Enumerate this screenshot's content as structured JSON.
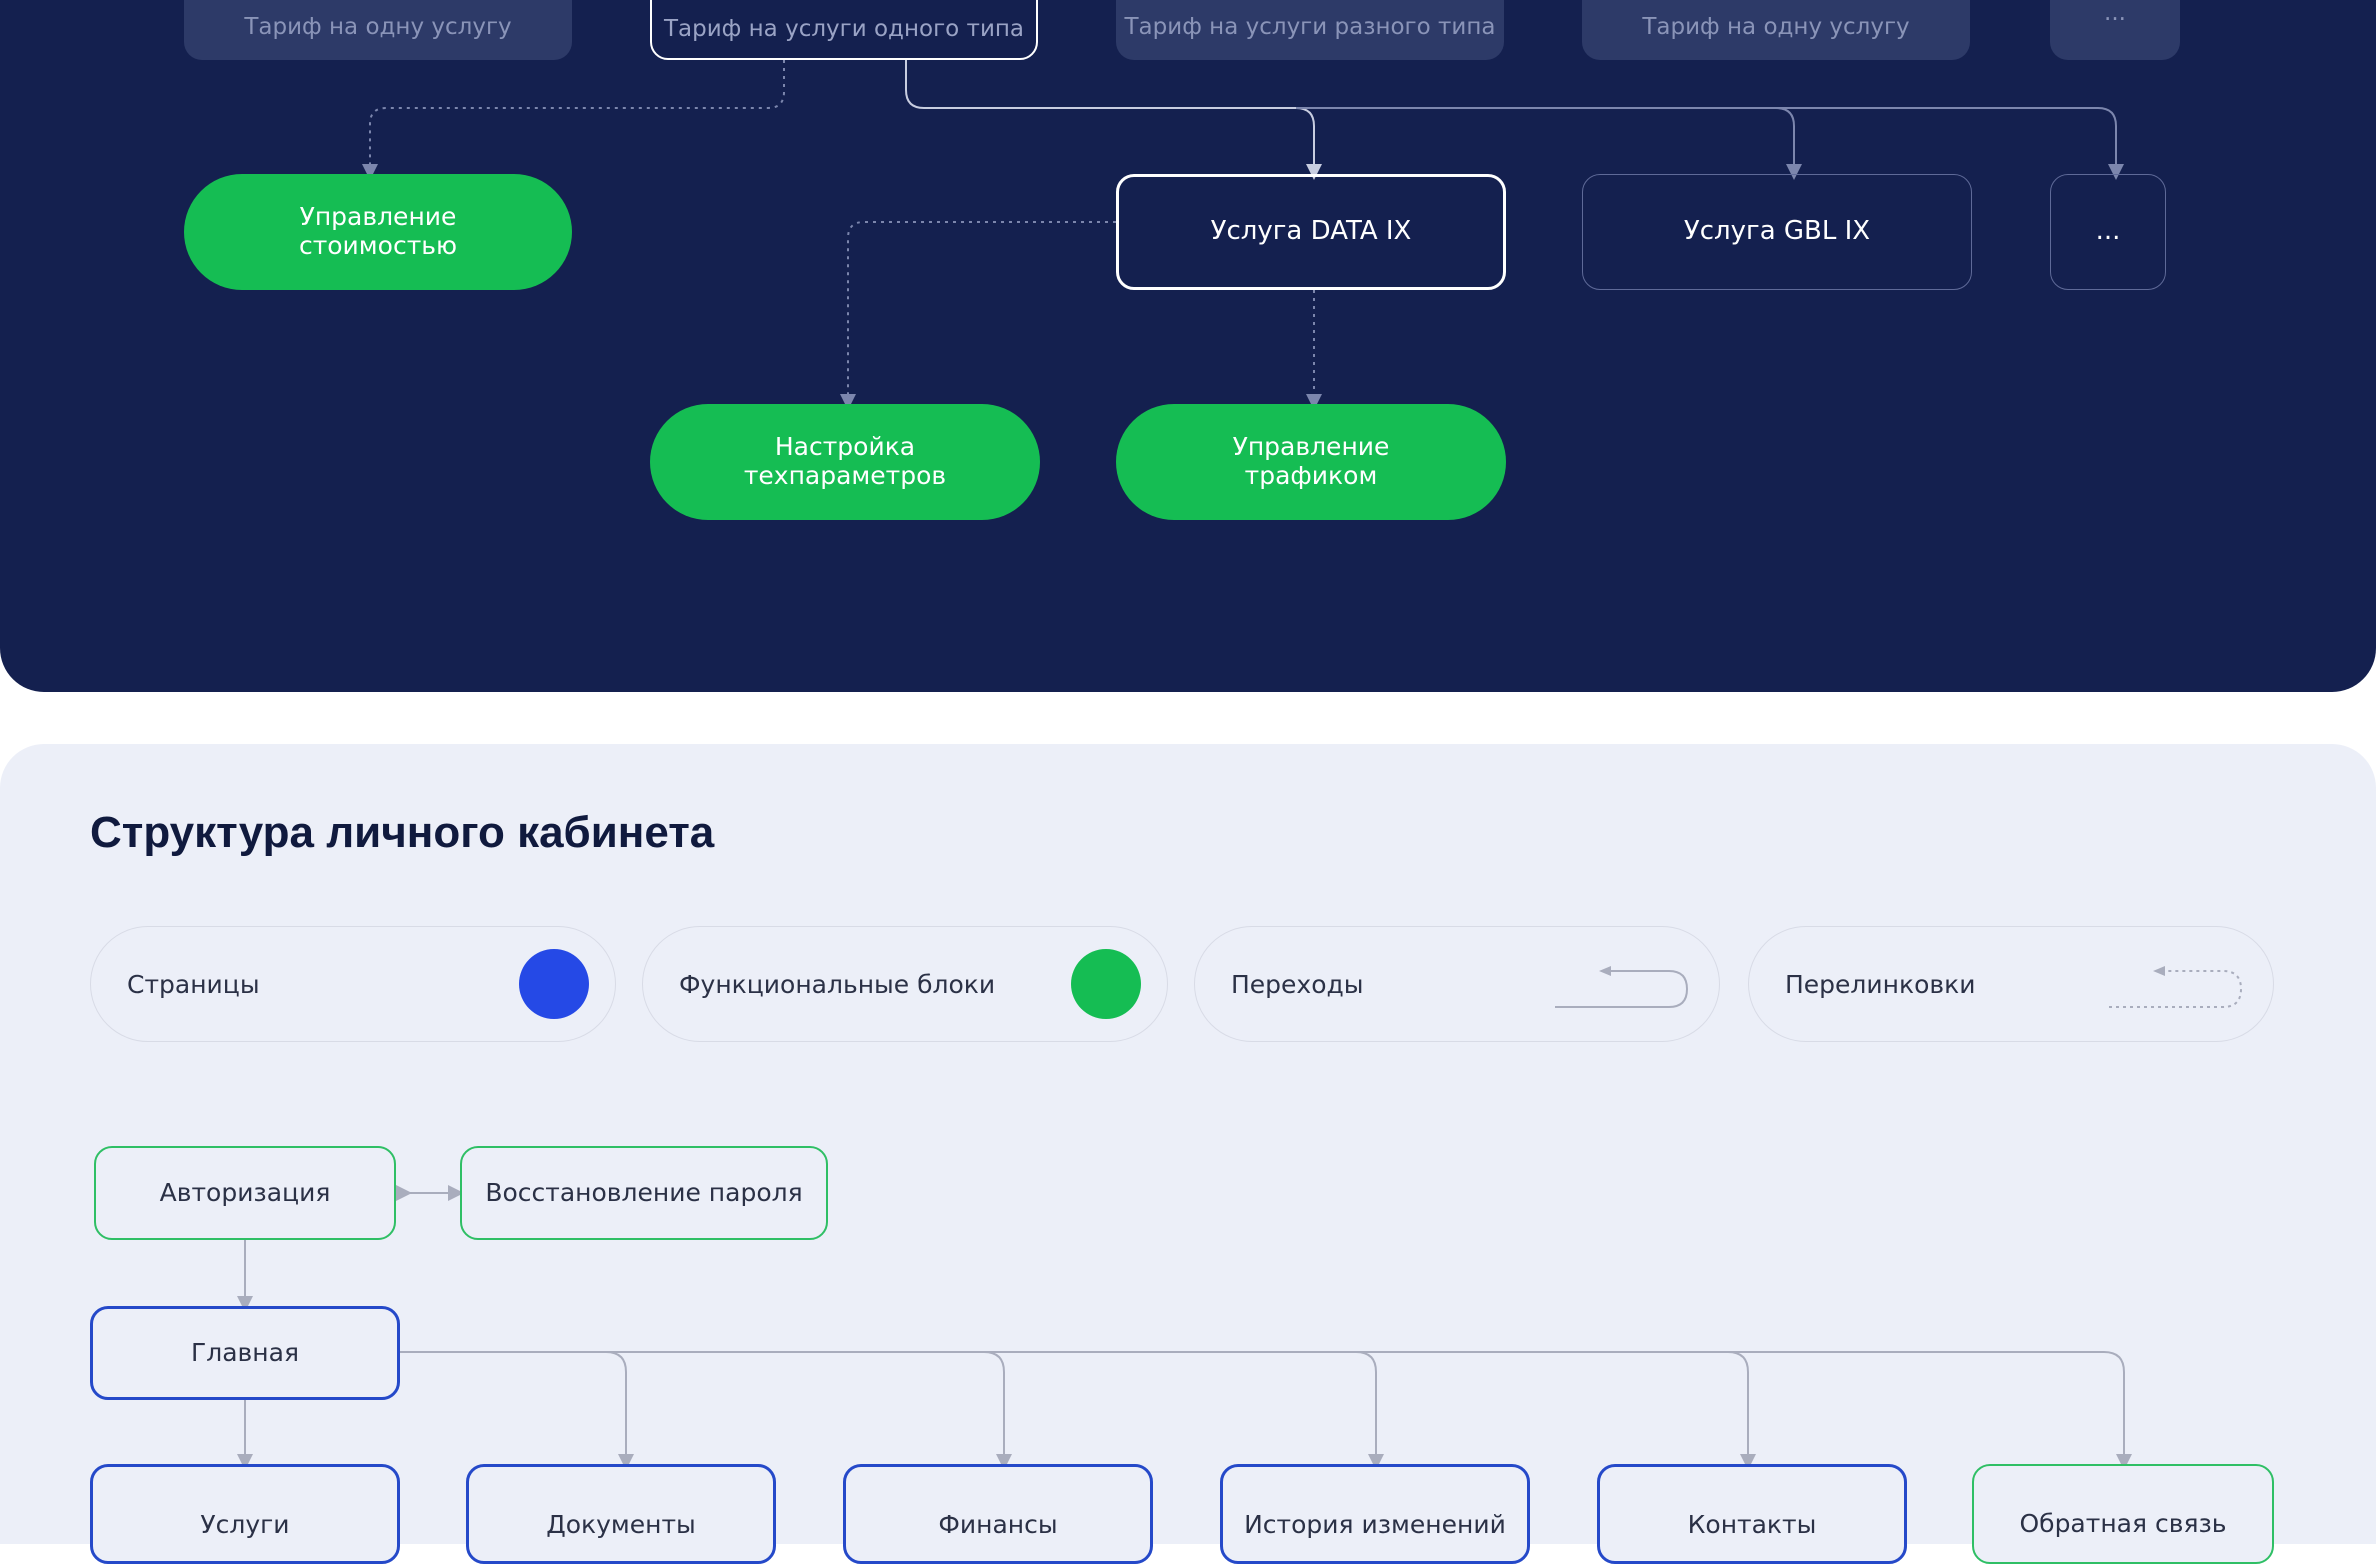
{
  "colors": {
    "dark_bg": "#14204f",
    "light_bg": "#eceff8",
    "page_blue": "#2549c9",
    "function_green": "#15bd53",
    "line_gray": "#a9adbd"
  },
  "tariffs": [
    {
      "label": "Тариф на одну услугу"
    },
    {
      "label": "Тариф на услуги одного типа"
    },
    {
      "label": "Тариф на услуги разного типа"
    },
    {
      "label": "Тариф на одну услугу"
    },
    {
      "label": "..."
    }
  ],
  "services": [
    {
      "label": "Услуга DATA IX"
    },
    {
      "label": "Услуга GBL IX"
    },
    {
      "label": "..."
    }
  ],
  "functions": {
    "cost": {
      "line1": "Управление",
      "line2": "стоимостью"
    },
    "params": {
      "line1": "Настройка",
      "line2": "техпараметров"
    },
    "traffic": {
      "line1": "Управление",
      "line2": "трафиком"
    }
  },
  "cabinet": {
    "title": "Структура личного кабинета",
    "legend": {
      "pages": "Страницы",
      "blocks": "Функциональные блоки",
      "transitions": "Переходы",
      "links": "Перелинковки"
    },
    "auth": "Авторизация",
    "password_recovery": "Восстановление пароля",
    "main": "Главная",
    "sections": [
      {
        "label": "Услуги"
      },
      {
        "label": "Документы"
      },
      {
        "label": "Финансы"
      },
      {
        "label": "История изменений"
      },
      {
        "label": "Контакты"
      },
      {
        "label": "Обратная связь"
      }
    ]
  }
}
